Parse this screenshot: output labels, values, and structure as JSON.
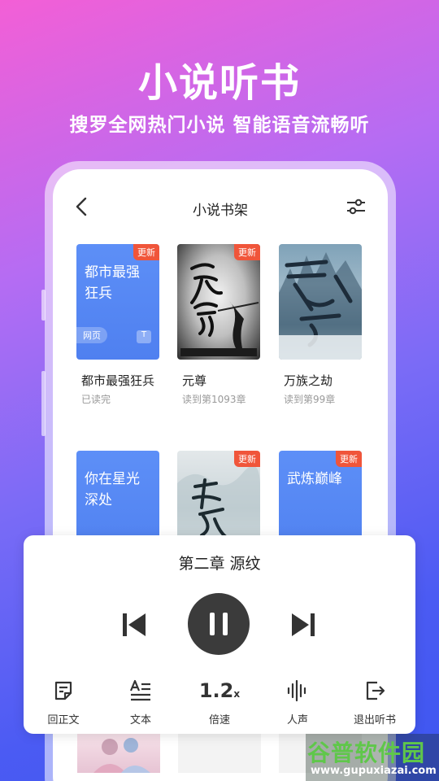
{
  "promo": {
    "title": "小说听书",
    "subtitle": "搜罗全网热门小说 智能语音流畅听"
  },
  "topbar": {
    "title": "小说书架"
  },
  "books": [
    {
      "cover_text": "都市最强狂兵",
      "badge": "更新",
      "tag": "网页",
      "tag2": "T",
      "title": "都市最强狂兵",
      "progress": "已读完"
    },
    {
      "cover_text": "",
      "badge": "更新",
      "title": "元尊",
      "progress": "读到第1093章"
    },
    {
      "cover_text": "",
      "badge": "",
      "title": "万族之劫",
      "progress": "读到第99章"
    },
    {
      "cover_text": "你在星光深处",
      "badge": "",
      "title": "",
      "progress": ""
    },
    {
      "cover_text": "",
      "badge": "更新",
      "title": "",
      "progress": ""
    },
    {
      "cover_text": "武炼巅峰",
      "badge": "更新",
      "title": "",
      "progress": ""
    }
  ],
  "player": {
    "chapter": "第二章 源纹",
    "speed_value": "1.2",
    "speed_unit": "x",
    "tools": [
      {
        "icon": "note-icon",
        "label": "回正文"
      },
      {
        "icon": "text-icon",
        "label": "文本"
      },
      {
        "icon": "speed",
        "label": "倍速"
      },
      {
        "icon": "voice-wave-icon",
        "label": "人声"
      },
      {
        "icon": "exit-icon",
        "label": "退出听书"
      }
    ]
  },
  "watermark": {
    "brand": "谷普软件园",
    "url": "www.gupuxiazai.com"
  },
  "colors": {
    "accent_blue": "#4f80f0",
    "badge_red": "#f0553a",
    "pause_button": "#3b3b3b"
  }
}
